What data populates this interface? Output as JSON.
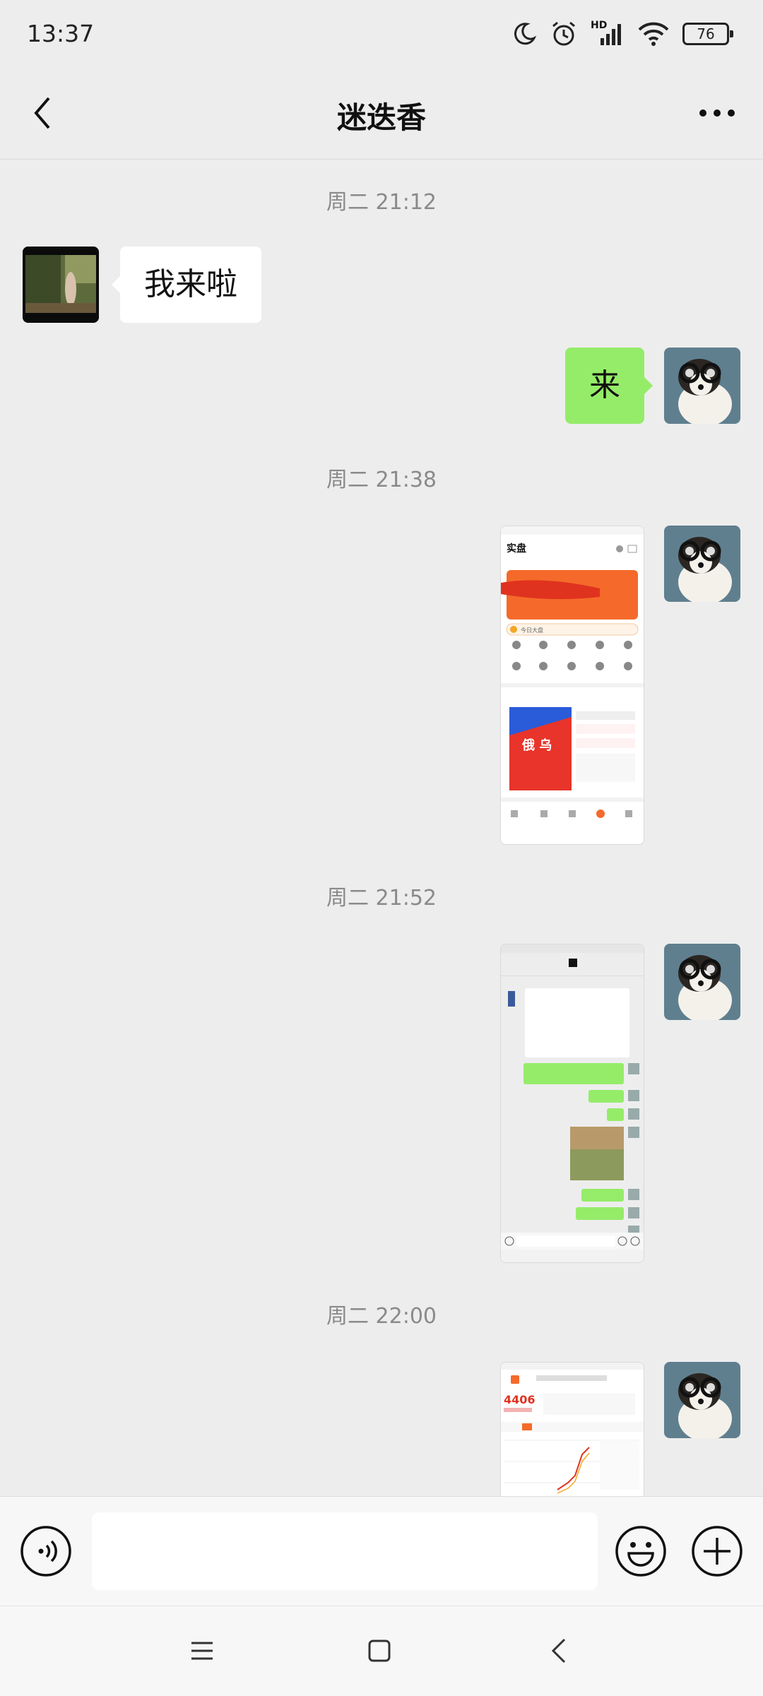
{
  "status_bar": {
    "time": "13:37",
    "hd_label": "HD",
    "battery": "76",
    "icons": [
      "moon-icon",
      "alarm-icon",
      "signal-icon",
      "wifi-icon",
      "battery-icon"
    ]
  },
  "header": {
    "title": "迷迭香",
    "back_icon": "chevron-left-icon",
    "more_icon": "more-dots-icon"
  },
  "messages": [
    {
      "type": "timestamp",
      "text": "周二 21:12"
    },
    {
      "type": "text",
      "direction": "incoming",
      "text": "我来啦"
    },
    {
      "type": "text",
      "direction": "outgoing",
      "text": "来"
    },
    {
      "type": "timestamp",
      "text": "周二 21:38"
    },
    {
      "type": "image",
      "direction": "outgoing",
      "content": "screenshot-shipan-app"
    },
    {
      "type": "timestamp",
      "text": "周二 21:52"
    },
    {
      "type": "image",
      "direction": "outgoing",
      "content": "screenshot-chat"
    },
    {
      "type": "timestamp",
      "text": "周二 22:00"
    },
    {
      "type": "image",
      "direction": "outgoing",
      "content": "screenshot-stock-chart"
    }
  ],
  "thumb1": {
    "title": "实盘",
    "card_text": "今日大盘"
  },
  "thumb3": {
    "price": "4406"
  },
  "input_bar": {
    "placeholder": "",
    "voice_icon": "voice-icon",
    "emoji_icon": "emoji-icon",
    "plus_icon": "plus-icon"
  },
  "nav_bar": {
    "icons": [
      "menu-icon",
      "home-square-icon",
      "back-triangle-icon"
    ]
  },
  "colors": {
    "background": "#ededed",
    "outgoing_bubble": "#95ec69",
    "incoming_bubble": "#ffffff",
    "timestamp": "#8a8a8a"
  }
}
